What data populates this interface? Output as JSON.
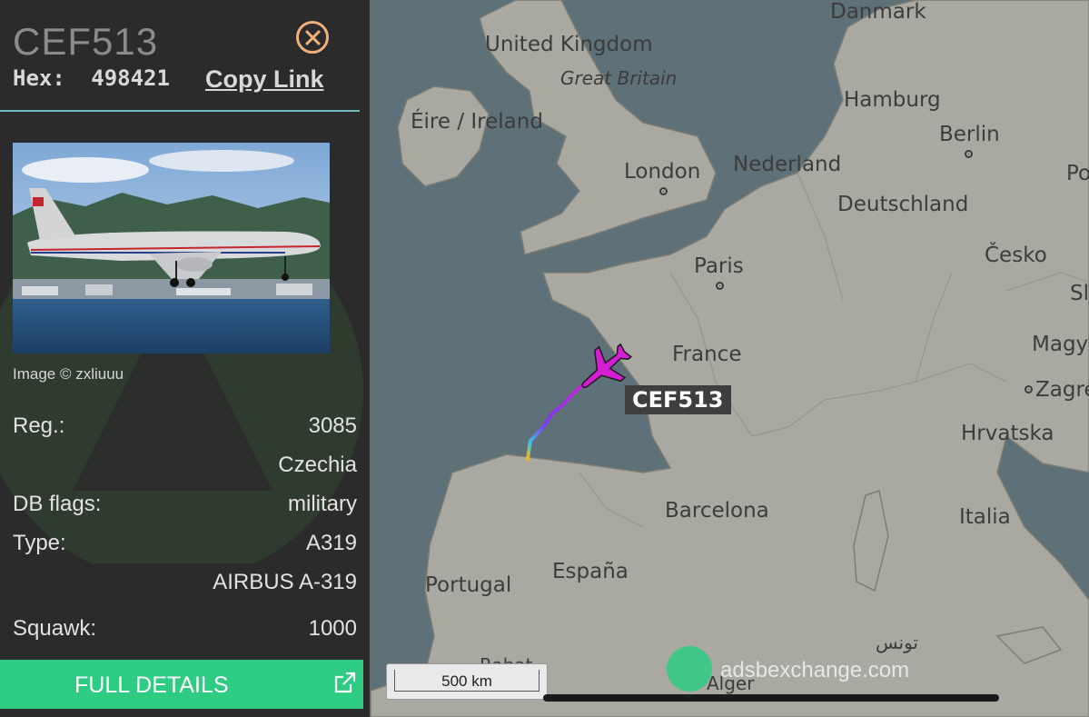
{
  "aircraft": {
    "callsign": "CEF513",
    "hex_label": "Hex:",
    "hex": "498421",
    "copy_link": "Copy Link",
    "image_credit": "Image © zxliuuu"
  },
  "details": [
    {
      "label": "Reg.:",
      "value": "3085"
    },
    {
      "label": "",
      "value": "Czechia"
    },
    {
      "label": "DB flags:",
      "value": "military"
    },
    {
      "label": "Type:",
      "value": "A319"
    },
    {
      "label": "",
      "value": "AIRBUS A-319"
    },
    {
      "label": "Squawk:",
      "value": "1000"
    }
  ],
  "full_details_label": "FULL DETAILS",
  "map": {
    "labels": {
      "danmark": "Danmark",
      "uk": "United Kingdom",
      "gb": "Great Britain",
      "hamburg": "Hamburg",
      "eire": "Éire / Ireland",
      "berlin": "Berlin",
      "london": "London",
      "nederland": "Nederland",
      "po": "Po",
      "deutschland": "Deutschland",
      "cesko": "Česko",
      "paris": "Paris",
      "slo": "Slo",
      "france": "France",
      "magya": "Magya",
      "zagre": "Zagre",
      "hrvatska": "Hrvatska",
      "barcelona": "Barcelona",
      "italia": "Italia",
      "portugal": "Portugal",
      "espana": "España",
      "tunis": "تونس",
      "rabat": "Rabat",
      "alger": "Alger"
    },
    "aircraft_label": "CEF513",
    "scale_label": "500 km",
    "brand": "adsbexchange.com"
  },
  "colors": {
    "track_start": "#f2b70f",
    "track_mid": "#7a3cf0",
    "track_end": "#d41ed4",
    "accent_green": "#2ecc82",
    "close_icon": "#f0b07a"
  }
}
